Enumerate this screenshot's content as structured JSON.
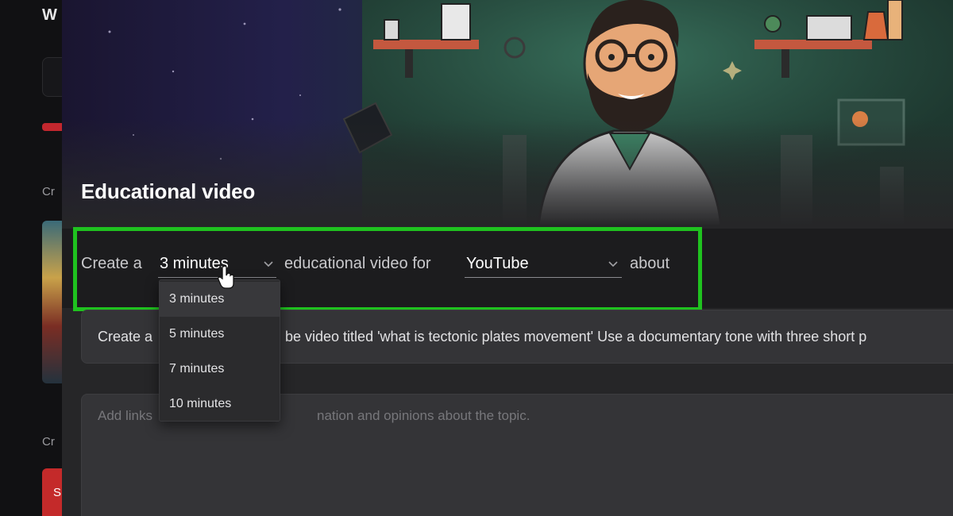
{
  "background": {
    "title_fragment": "W",
    "labels": [
      "Cr",
      "Cr"
    ],
    "card_text": "S"
  },
  "modal": {
    "title": "Educational video",
    "sentence": {
      "part1": "Create a",
      "duration_value": "3 minutes",
      "part2": "educational video for",
      "platform_value": "YouTube",
      "part3": "about"
    },
    "duration_options": [
      "3 minutes",
      "5 minutes",
      "7 minutes",
      "10 minutes"
    ],
    "selected_duration": "3 minutes",
    "prompt_text_start": "Create a",
    "prompt_text_end": "be video titled 'what is tectonic plates movement' Use a documentary tone with three short p",
    "info_placeholder_start": "Add links",
    "info_placeholder_end": "nation and opinions about the topic."
  },
  "colors": {
    "highlight": "#1fc21f",
    "panel": "#262628",
    "field": "#343437"
  },
  "icons": [
    "chevron-down-icon",
    "hand-cursor-icon"
  ]
}
